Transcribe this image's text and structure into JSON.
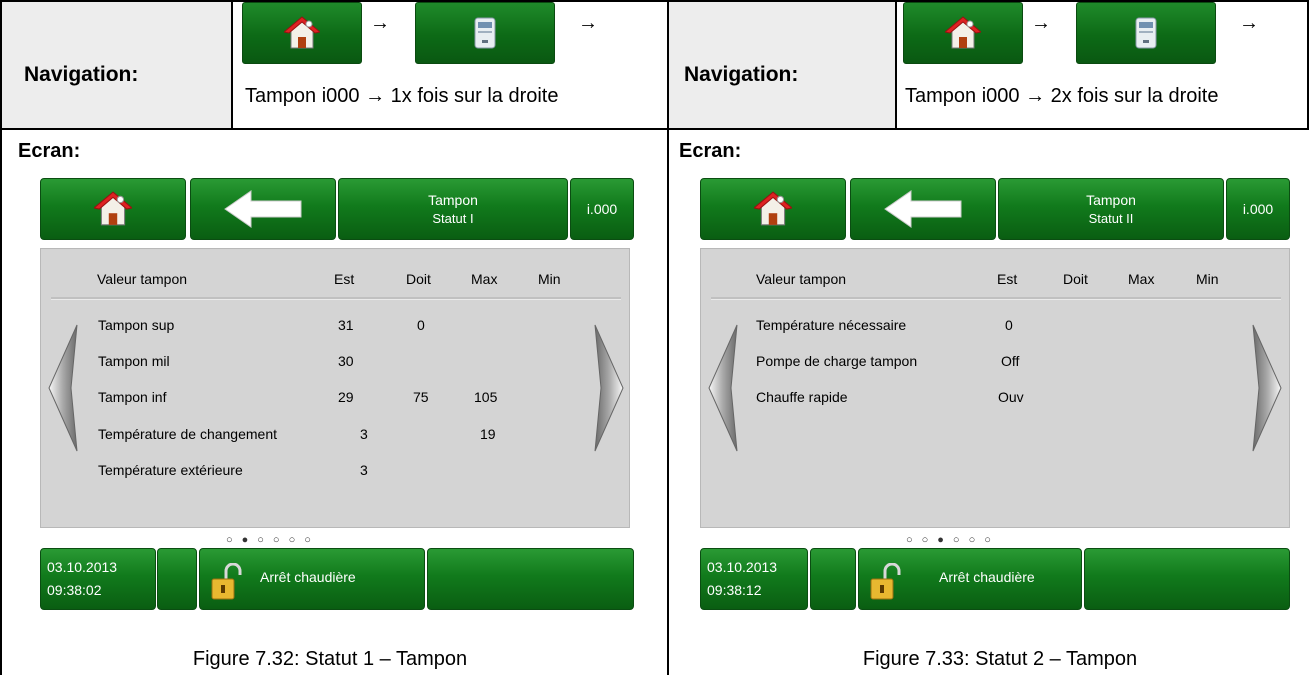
{
  "left": {
    "nav_label": "Navigation:",
    "nav_path": "Tampon i000 → 1x fois sur la droite",
    "screen_label": "Ecran:",
    "caption": "Figure 7.32: Statut 1 – Tampon",
    "screen": {
      "title_line1": "Tampon",
      "title_line2": "Statut I",
      "code": "i.000",
      "headers": {
        "label": "Valeur tampon",
        "est": "Est",
        "doit": "Doit",
        "max": "Max",
        "min": "Min"
      },
      "rows": [
        {
          "label": "Tampon sup",
          "est": "31",
          "doit": "0",
          "max": "",
          "min": ""
        },
        {
          "label": "Tampon mil",
          "est": "30",
          "doit": "",
          "max": "",
          "min": ""
        },
        {
          "label": "Tampon inf",
          "est": "29",
          "doit": "75",
          "max": "105",
          "min": ""
        },
        {
          "label": "Température de changement",
          "est": "3",
          "doit": "",
          "max": "19",
          "min": ""
        },
        {
          "label": "Température extérieure",
          "est": "3",
          "doit": "",
          "max": "",
          "min": ""
        }
      ],
      "page_dots": "○●○○○○",
      "date": "03.10.2013",
      "time": "09:38:02",
      "status": "Arrêt chaudière"
    }
  },
  "right": {
    "nav_label": "Navigation:",
    "nav_path": "Tampon i000 → 2x fois sur la droite",
    "screen_label": "Ecran:",
    "caption": "Figure 7.33: Statut 2 – Tampon",
    "screen": {
      "title_line1": "Tampon",
      "title_line2": "Statut II",
      "code": "i.000",
      "headers": {
        "label": "Valeur tampon",
        "est": "Est",
        "doit": "Doit",
        "max": "Max",
        "min": "Min"
      },
      "rows": [
        {
          "label": "Température nécessaire",
          "est": "0",
          "doit": "",
          "max": "",
          "min": ""
        },
        {
          "label": "Pompe de charge tampon",
          "est": "Off",
          "doit": "",
          "max": "",
          "min": ""
        },
        {
          "label": "Chauffe rapide",
          "est": "Ouv",
          "doit": "",
          "max": "",
          "min": ""
        }
      ],
      "page_dots": "○○●○○○",
      "date": "03.10.2013",
      "time": "09:38:12",
      "status": "Arrêt chaudière"
    }
  },
  "nav_arrow": "→",
  "icons": [
    "home-icon",
    "boiler-icon",
    "back-arrow-icon",
    "chevron-left-icon",
    "chevron-right-icon",
    "padlock-unlocked-icon"
  ],
  "colors": {
    "button_green": "#117a1c",
    "panel_grey": "#d4d4d4",
    "nav_cell_bg": "#ededed"
  }
}
